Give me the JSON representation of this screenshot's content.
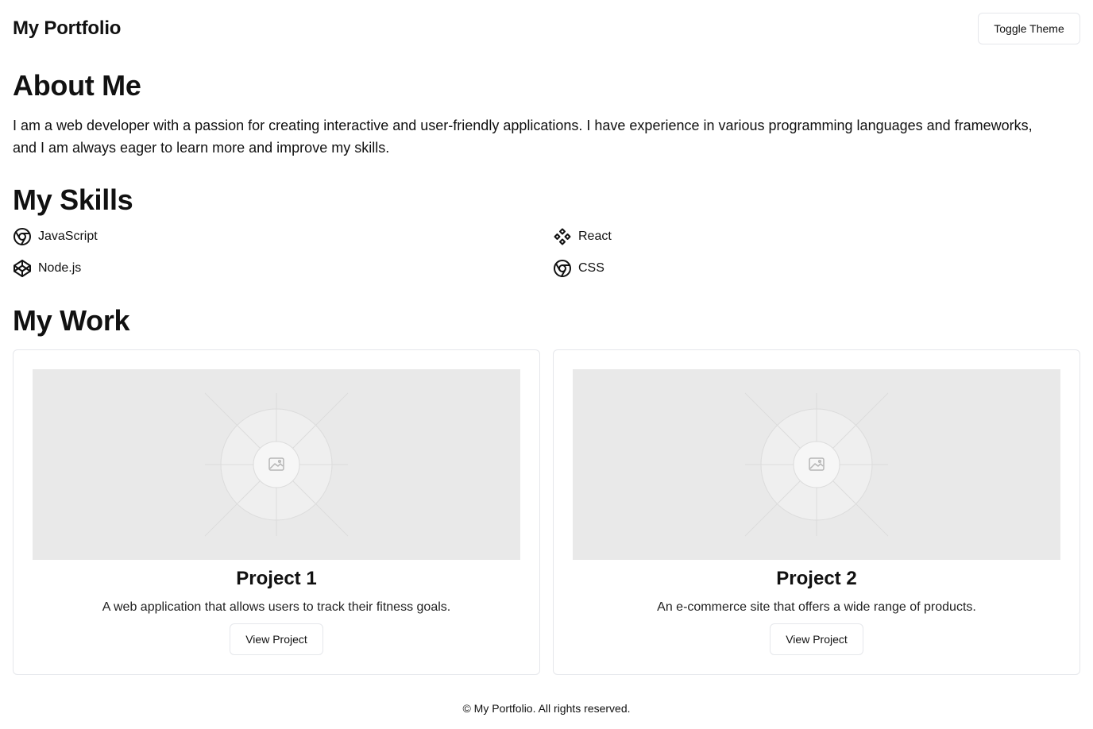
{
  "header": {
    "title": "My Portfolio",
    "toggle_theme_label": "Toggle Theme"
  },
  "about": {
    "title": "About Me",
    "text": "I am a web developer with a passion for creating interactive and user-friendly applications. I have experience in various programming languages and frameworks, and I am always eager to learn more and improve my skills."
  },
  "skills": {
    "title": "My Skills",
    "items": [
      {
        "label": "JavaScript",
        "icon": "chrome-icon"
      },
      {
        "label": "React",
        "icon": "diamond-cluster-icon"
      },
      {
        "label": "Node.js",
        "icon": "codepen-icon"
      },
      {
        "label": "CSS",
        "icon": "chrome-icon"
      }
    ]
  },
  "work": {
    "title": "My Work",
    "projects": [
      {
        "title": "Project 1",
        "description": "A web application that allows users to track their fitness goals.",
        "button_label": "View Project",
        "image_icon": "image-placeholder-icon"
      },
      {
        "title": "Project 2",
        "description": "An e-commerce site that offers a wide range of products.",
        "button_label": "View Project",
        "image_icon": "image-placeholder-icon"
      }
    ]
  },
  "footer": {
    "text": "© My Portfolio. All rights reserved."
  },
  "colors": {
    "background": "#ffffff",
    "text": "#111111",
    "border": "#e5e7eb",
    "placeholder": "#e9e9e9"
  }
}
